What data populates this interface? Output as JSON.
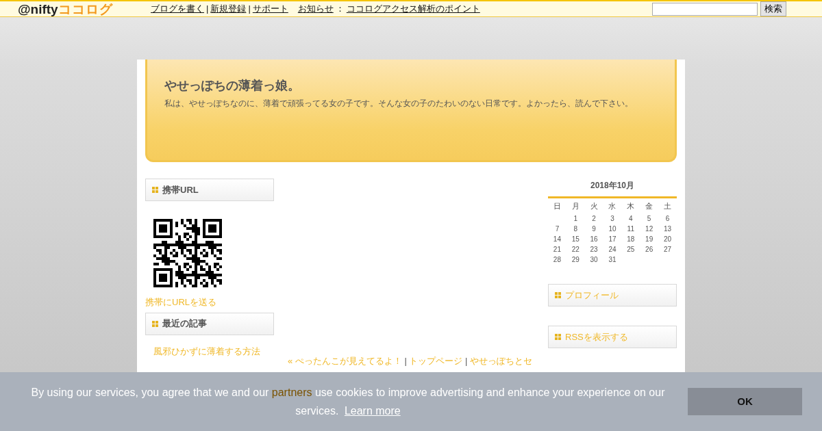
{
  "topbar": {
    "logo": {
      "brand": "@nifty",
      "service": "ココログ"
    },
    "links": [
      {
        "label": "ブログを書く",
        "kind": "link"
      },
      {
        "label": "|",
        "kind": "sep"
      },
      {
        "label": "新規登録",
        "kind": "link"
      },
      {
        "label": "|",
        "kind": "sep"
      },
      {
        "label": "サポート",
        "kind": "link"
      },
      {
        "label": "お知らせ",
        "kind": "link"
      },
      {
        "label": "：",
        "kind": "sep"
      },
      {
        "label": "ココログアクセス解析のポイント",
        "kind": "link"
      }
    ],
    "search": {
      "button": "検索"
    }
  },
  "header": {
    "title": "やせっぽちの薄着っ娘。",
    "description": "私は、やせっぽちなのに、薄着で頑張ってる女の子です。そんな女の子のたわいのない日常です。よかったら、読んで下さい。"
  },
  "left_sidebar": [
    {
      "kind": "qr",
      "title": "携帯URL",
      "link": "携帯にURLを送る"
    },
    {
      "kind": "list",
      "title": "最近の記事",
      "items": [
        "風邪ひかずに薄着する方法"
      ]
    }
  ],
  "post_nav": [
    {
      "label": "« ぺったんこが見えてるよ！",
      "kind": "link"
    },
    {
      "label": "|",
      "kind": "sep"
    },
    {
      "label": "トップページ",
      "kind": "link"
    },
    {
      "label": "|",
      "kind": "sep"
    },
    {
      "label": "やせっぽちとセ",
      "kind": "link"
    }
  ],
  "calendar": {
    "title": "2018年10月",
    "weekdays": [
      "日",
      "月",
      "火",
      "水",
      "木",
      "金",
      "土"
    ],
    "weeks": [
      {
        "kind": "first",
        "days": [
          "1",
          "2",
          "3",
          "4",
          "5",
          "6"
        ]
      },
      {
        "kind": "full",
        "days": [
          "7",
          "8",
          "9",
          "10",
          "11",
          "12",
          "13"
        ]
      },
      {
        "kind": "full",
        "days": [
          "14",
          "15",
          "16",
          "17",
          "18",
          "19",
          "20"
        ]
      },
      {
        "kind": "full",
        "days": [
          "21",
          "22",
          "23",
          "24",
          "25",
          "26",
          "27"
        ]
      },
      {
        "kind": "last",
        "days": [
          "28",
          "29",
          "30",
          "31"
        ]
      }
    ]
  },
  "right_sidebar": [
    {
      "title": "プロフィール"
    },
    {
      "title": "RSSを表示する"
    }
  ],
  "cookie_banner": {
    "text_before": "By using our services, you agree that we and our",
    "partners": "partners",
    "text_after": "use cookies to improve advertising and enhance your experience on our services.",
    "learn_more": "Learn more",
    "button": "OK"
  }
}
